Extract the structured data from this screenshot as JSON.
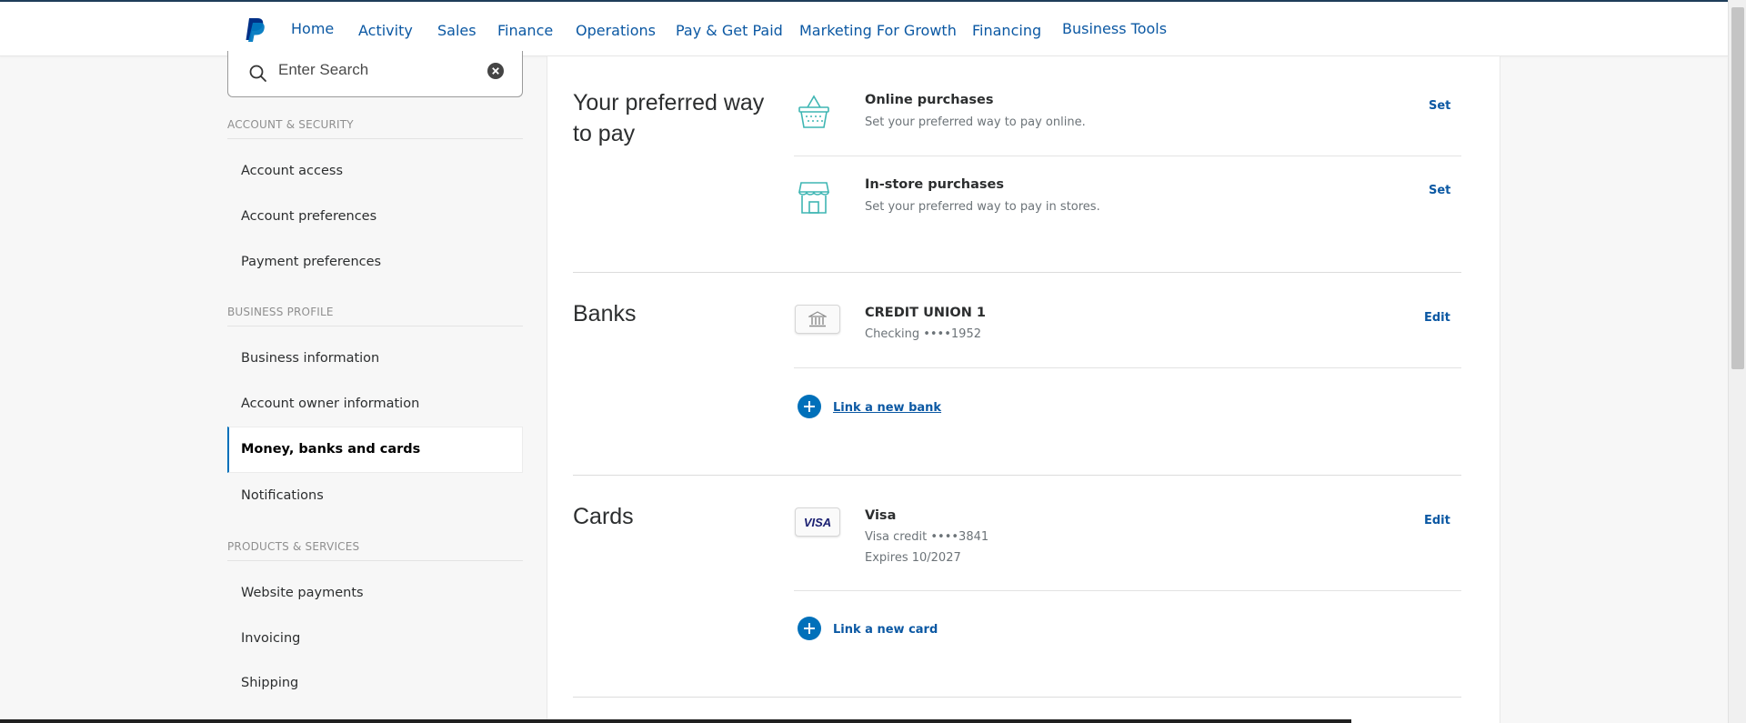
{
  "nav": {
    "items": [
      "Home",
      "Activity",
      "Sales",
      "Finance",
      "Operations",
      "Pay & Get Paid",
      "Marketing For Growth",
      "Financing",
      "Business Tools"
    ]
  },
  "sidebar": {
    "search_placeholder": "Enter Search",
    "sections": [
      {
        "title": "ACCOUNT & SECURITY",
        "items": [
          "Account access",
          "Account preferences",
          "Payment preferences"
        ]
      },
      {
        "title": "BUSINESS PROFILE",
        "items": [
          "Business information",
          "Account owner information",
          "Money, banks and cards",
          "Notifications"
        ]
      },
      {
        "title": "PRODUCTS & SERVICES",
        "items": [
          "Website payments",
          "Invoicing",
          "Shipping"
        ]
      }
    ],
    "active_item": "Money, banks and cards"
  },
  "main": {
    "preferred": {
      "heading": "Your preferred way to pay",
      "rows": [
        {
          "title": "Online purchases",
          "subtitle": "Set your preferred way to pay online.",
          "action": "Set",
          "icon": "basket-icon"
        },
        {
          "title": "In-store purchases",
          "subtitle": "Set your preferred way to pay in stores.",
          "action": "Set",
          "icon": "storefront-icon"
        }
      ]
    },
    "banks": {
      "heading": "Banks",
      "bank": {
        "name": "CREDIT UNION 1",
        "detail": "Checking ••••1952",
        "action": "Edit",
        "icon": "bank-icon"
      },
      "link_label": "Link a new bank"
    },
    "cards": {
      "heading": "Cards",
      "card": {
        "name": "Visa",
        "detail": "Visa credit ••••3841",
        "expiry": "Expires 10/2027",
        "action": "Edit",
        "brand_mark": "VISA"
      },
      "link_label": "Link a new card"
    }
  },
  "colors": {
    "brand_blue": "#0070ba",
    "link_blue": "#0b58a3",
    "visa_navy": "#1a1f71",
    "icon_teal": "#3fb6b3"
  }
}
